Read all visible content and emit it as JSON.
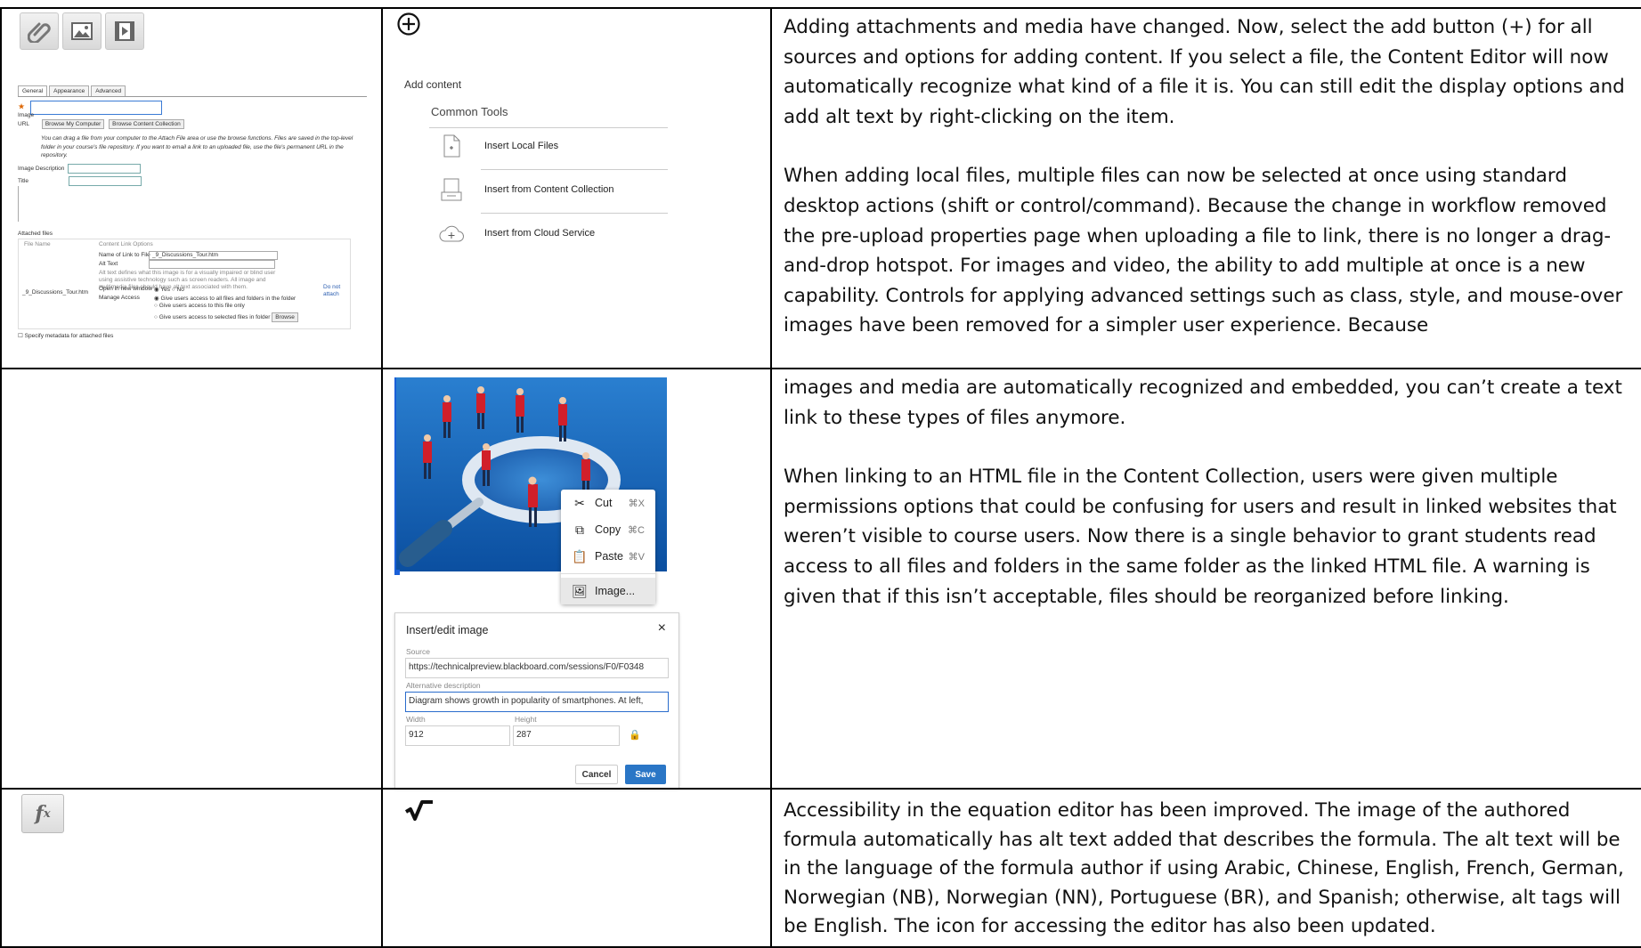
{
  "row1": {
    "old_toolbar_icons": [
      "paperclip-icon",
      "image-icon",
      "media-icon"
    ],
    "old_form": {
      "tabs": [
        "General",
        "Appearance",
        "Advanced"
      ],
      "image_label": "Image",
      "url_label": "URL",
      "browse_my_computer": "Browse My Computer",
      "browse_content_collection": "Browse Content Collection",
      "help_text": "You can drag a file from your computer to the Attach File area or use the browse functions. Files are saved in the top-level folder in your course's file repository. If you want to email a link to an uploaded file, use the file's permanent URL in the repository.",
      "image_description_label": "Image Description",
      "title_label": "Title",
      "attached_files_label": "Attached files",
      "file_name_header": "File Name",
      "content_link_options_header": "Content Link Options",
      "file_name": "_9_Discussions_Tour.htm",
      "name_of_link_label": "Name of Link to File",
      "name_of_link_value": "_9_Discussions_Tour.htm",
      "alt_text_label": "Alt Text",
      "alt_text_help": "Alt text defines what this image is for a visually impaired or blind user using assistive technology such as screen readers. All image and multimedia files should have alt text associated with them.",
      "open_new_window_label": "Open in new window",
      "yes": "Yes",
      "no": "No",
      "manage_access_label": "Manage Access",
      "access_opt1": "Give users access to all files and folders in the folder",
      "access_opt2": "Give users access to this file only",
      "access_opt3": "Give users access to selected files in folder",
      "browse": "Browse",
      "do_not_attach": "Do not attach",
      "specify_metadata": "Specify metadata for attached files"
    },
    "add_content": {
      "heading": "Add content",
      "group": "Common Tools",
      "items": [
        "Insert Local Files",
        "Insert from Content Collection",
        "Insert from Cloud Service"
      ]
    },
    "description_p1": "Adding attachments and media have changed. Now, select the add button (+) for all sources and options for adding content. If you select a file, the Content Editor will now automatically recognize what kind of a file it is. You can still edit the display options and add alt text by right-clicking on the item.",
    "description_p2": "When adding local files, multiple files can now be selected at once using standard desktop actions (shift or control/command). Because the change in workflow removed the pre-upload properties page when uploading a file to link, there is no longer a drag-and-drop hotspot. For images and video, the ability to add multiple at once is a new capability. Controls for applying advanced settings such as class, style, and mouse-over images have been removed for a simpler user experience. Because"
  },
  "row2": {
    "context_menu": {
      "cut": "Cut",
      "cut_key": "⌘X",
      "copy": "Copy",
      "copy_key": "⌘C",
      "paste": "Paste",
      "paste_key": "⌘V",
      "image": "Image..."
    },
    "dialog": {
      "title": "Insert/edit image",
      "close": "×",
      "source_label": "Source",
      "source_value": "https://technicalpreview.blackboard.com/sessions/F0/F0348",
      "alt_label": "Alternative description",
      "alt_value": "Diagram shows growth in popularity of smartphones. At left,",
      "width_label": "Width",
      "width_value": "912",
      "height_label": "Height",
      "height_value": "287",
      "cancel": "Cancel",
      "save": "Save"
    },
    "description_p1": "images and media are automatically recognized and embedded, you can’t create a text link to these types of files anymore.",
    "description_p2": "When linking to an HTML file in the Content Collection, users were given multiple permissions options that could be confusing for users and result in linked websites that weren’t visible to course users. Now there is a single behavior to grant students read access to all files and folders in the same folder as the linked HTML file. A warning is given that if this isn’t acceptable, files should be reorganized before linking."
  },
  "row3": {
    "old_icon": "fx-icon",
    "new_icon": "sqrt-icon",
    "description": "Accessibility in the equation editor has been improved. The image of the authored formula automatically has alt text added that describes the formula. The alt text will be in the language of the formula author if using Arabic, Chinese, English, French, German, Norwegian (NB), Norwegian (NN), Portuguese (BR), and Spanish; otherwise, alt tags will be English. The icon for accessing the editor has also been updated."
  }
}
